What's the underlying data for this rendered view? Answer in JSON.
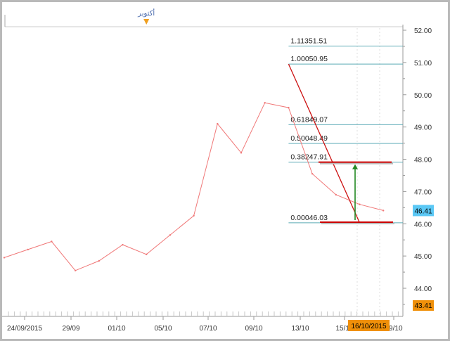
{
  "chart_data": {
    "type": "line",
    "title": "",
    "xlabel": "",
    "ylabel": "",
    "ylim": [
      43.2,
      52.3
    ],
    "y_ticks": [
      "52.00",
      "51.00",
      "50.00",
      "49.00",
      "48.00",
      "47.00",
      "46.00",
      "45.00",
      "44.00"
    ],
    "x_ticks": [
      "24/09/2015",
      "29/09",
      "01/10",
      "05/10",
      "07/10",
      "09/10",
      "13/10",
      "15/10",
      "16/10/2015",
      "19/10"
    ],
    "grid": false,
    "legend": "none",
    "event_marker": {
      "label": "أكتوبر",
      "date": "01/10"
    },
    "series": [
      {
        "color": "#f07878",
        "x": [
          "23/09",
          "24/09",
          "25/09",
          "28/09",
          "29/09",
          "30/09",
          "01/10",
          "02/10",
          "05/10",
          "06/10",
          "07/10",
          "08/10",
          "09/10",
          "12/10",
          "13/10",
          "14/10",
          "15/10"
        ],
        "values": [
          44.95,
          45.2,
          45.45,
          44.55,
          44.85,
          45.35,
          45.05,
          45.65,
          46.25,
          49.1,
          48.2,
          49.75,
          49.6,
          47.55,
          46.9,
          46.6,
          46.41
        ]
      }
    ],
    "trend_line": {
      "color": "#cc1111",
      "from": {
        "x": "09/10",
        "y": 50.95
      },
      "to": {
        "x": "14/10",
        "y": 46.03
      }
    },
    "fibonacci_levels": [
      {
        "ratio": "1.113",
        "price": "51.51"
      },
      {
        "ratio": "1.000",
        "price": "50.95"
      },
      {
        "ratio": "0.618",
        "price": "49.07"
      },
      {
        "ratio": "0.500",
        "price": "48.49"
      },
      {
        "ratio": "0.382",
        "price": "47.91"
      },
      {
        "ratio": "0.000",
        "price": "46.03"
      }
    ],
    "horizontal_lines": [
      {
        "price": 47.91,
        "color": "#cc0000"
      },
      {
        "price": 46.05,
        "color": "#cc0000"
      }
    ],
    "arrow": {
      "x": "15/10",
      "from": 46.05,
      "to": 47.91,
      "color": "#228822"
    },
    "current_price": {
      "label": "46.41",
      "value": 46.41,
      "color": "#5bc8f5"
    },
    "low_price": {
      "label": "43.41",
      "value": 43.41,
      "color": "#f0900a"
    },
    "cursor_date": {
      "label": "16/10/2015",
      "color": "#f0900a"
    },
    "colors": {
      "fib_line": "#5aaab5",
      "axis": "#9a9a9a",
      "background": "#ffffff"
    }
  }
}
